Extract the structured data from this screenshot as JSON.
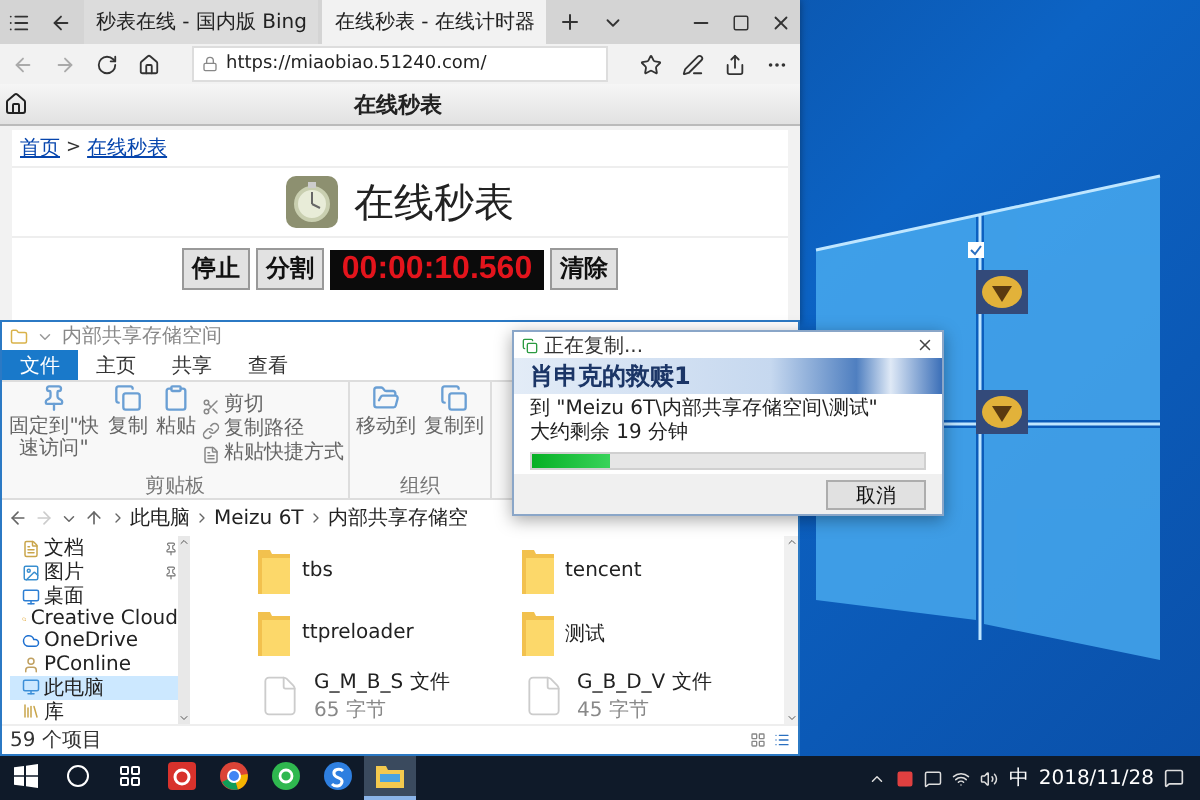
{
  "browser": {
    "tabs": [
      {
        "title": "秒表在线 - 国内版 Bing",
        "selected": false
      },
      {
        "title": "在线秒表 - 在线计时器",
        "selected": true
      }
    ],
    "url": "https://miaobiao.51240.com/",
    "page": {
      "header": "在线秒表",
      "breadcrumb": [
        "首页",
        "在线秒表"
      ],
      "breadcrumb_separator": ">",
      "heading": "在线秒表",
      "buttons": [
        "停止",
        "分割"
      ],
      "timer": "00:00:10.560",
      "clear_button": "清除"
    }
  },
  "explorer": {
    "title": "内部共享存储空间",
    "ribbon_tabs": [
      {
        "label": "文件",
        "kind": "file"
      },
      {
        "label": "主页",
        "kind": "tab"
      },
      {
        "label": "共享",
        "kind": "tab"
      },
      {
        "label": "查看",
        "kind": "tab"
      }
    ],
    "ribbon_groups": [
      {
        "label": "剪贴板",
        "items": [
          {
            "label": "固定到\"快速访问\"",
            "kind": "large"
          },
          {
            "label": "复制",
            "kind": "large"
          },
          {
            "label": "粘贴",
            "kind": "large"
          },
          {
            "label": "剪切",
            "kind": "small"
          },
          {
            "label": "复制路径",
            "kind": "small"
          },
          {
            "label": "粘贴快捷方式",
            "kind": "small"
          }
        ]
      },
      {
        "label": "组织",
        "items": [
          {
            "label": "移动到",
            "kind": "large"
          },
          {
            "label": "复制到",
            "kind": "large"
          }
        ]
      }
    ],
    "path": [
      "此电脑",
      "Meizu 6T",
      "内部共享存储空"
    ],
    "nav": [
      {
        "label": "文档",
        "selected": false,
        "pinned": true
      },
      {
        "label": "图片",
        "selected": false,
        "pinned": true
      },
      {
        "label": "桌面",
        "selected": false,
        "pinned": false
      },
      {
        "label": "Creative Cloud",
        "selected": false,
        "pinned": false
      },
      {
        "label": "OneDrive",
        "selected": false,
        "pinned": false
      },
      {
        "label": "PConline",
        "selected": false,
        "pinned": false
      },
      {
        "label": "此电脑",
        "selected": true,
        "pinned": false
      },
      {
        "label": "库",
        "selected": false,
        "pinned": false
      }
    ],
    "files": [
      {
        "name": "tbs",
        "kind": "folder"
      },
      {
        "name": "tencent",
        "kind": "folder"
      },
      {
        "name": "ttpreloader",
        "kind": "folder"
      },
      {
        "name": "测试",
        "kind": "folder"
      },
      {
        "name": "G_M_B_S 文件",
        "size": "65 字节",
        "kind": "file"
      },
      {
        "name": "G_B_D_V 文件",
        "size": "45 字节",
        "kind": "file"
      }
    ],
    "status": "59 个项目"
  },
  "copy_dialog": {
    "title": "正在复制...",
    "file": "肖申克的救赎1",
    "destination": "到 \"Meizu 6T\\内部共享存储空间\\测试\"",
    "remaining": "大约剩余 19 分钟",
    "level": 0.2,
    "cancel": "取消"
  },
  "taskbar": {
    "apps": [
      {
        "selected": false
      },
      {
        "selected": false
      },
      {
        "selected": false
      },
      {
        "selected": false
      },
      {
        "selected": false
      },
      {
        "selected": false
      },
      {
        "selected": false
      },
      {
        "selected": true
      }
    ],
    "ime": "中",
    "date": "2018/11/28"
  }
}
